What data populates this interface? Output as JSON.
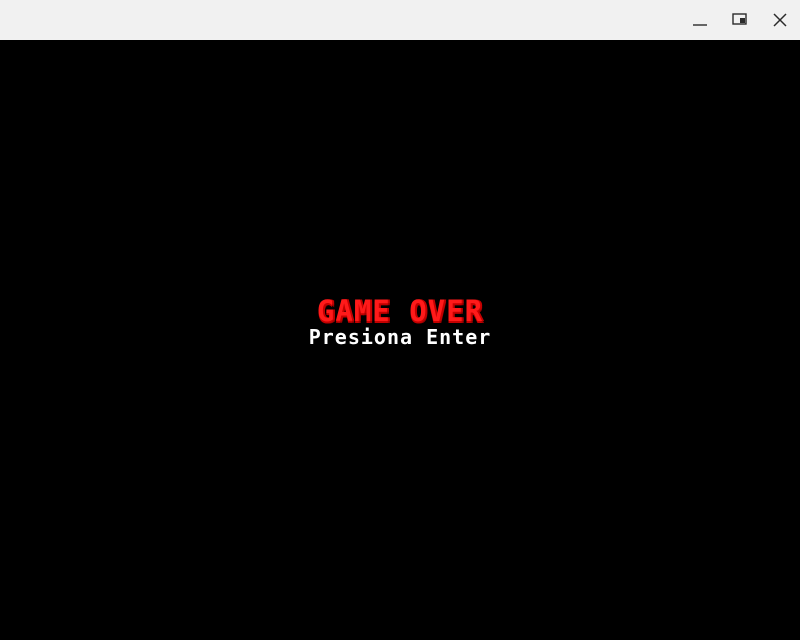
{
  "window": {
    "controls": {
      "minimize_icon": "minimize-icon",
      "restore_icon": "restore-icon",
      "close_icon": "close-icon"
    }
  },
  "game": {
    "title": "GAME OVER",
    "subtitle": "Presiona Enter",
    "colors": {
      "background": "#000000",
      "title": "#ff1a1a",
      "subtitle": "#ffffff",
      "titlebar": "#f1f1f1"
    }
  }
}
